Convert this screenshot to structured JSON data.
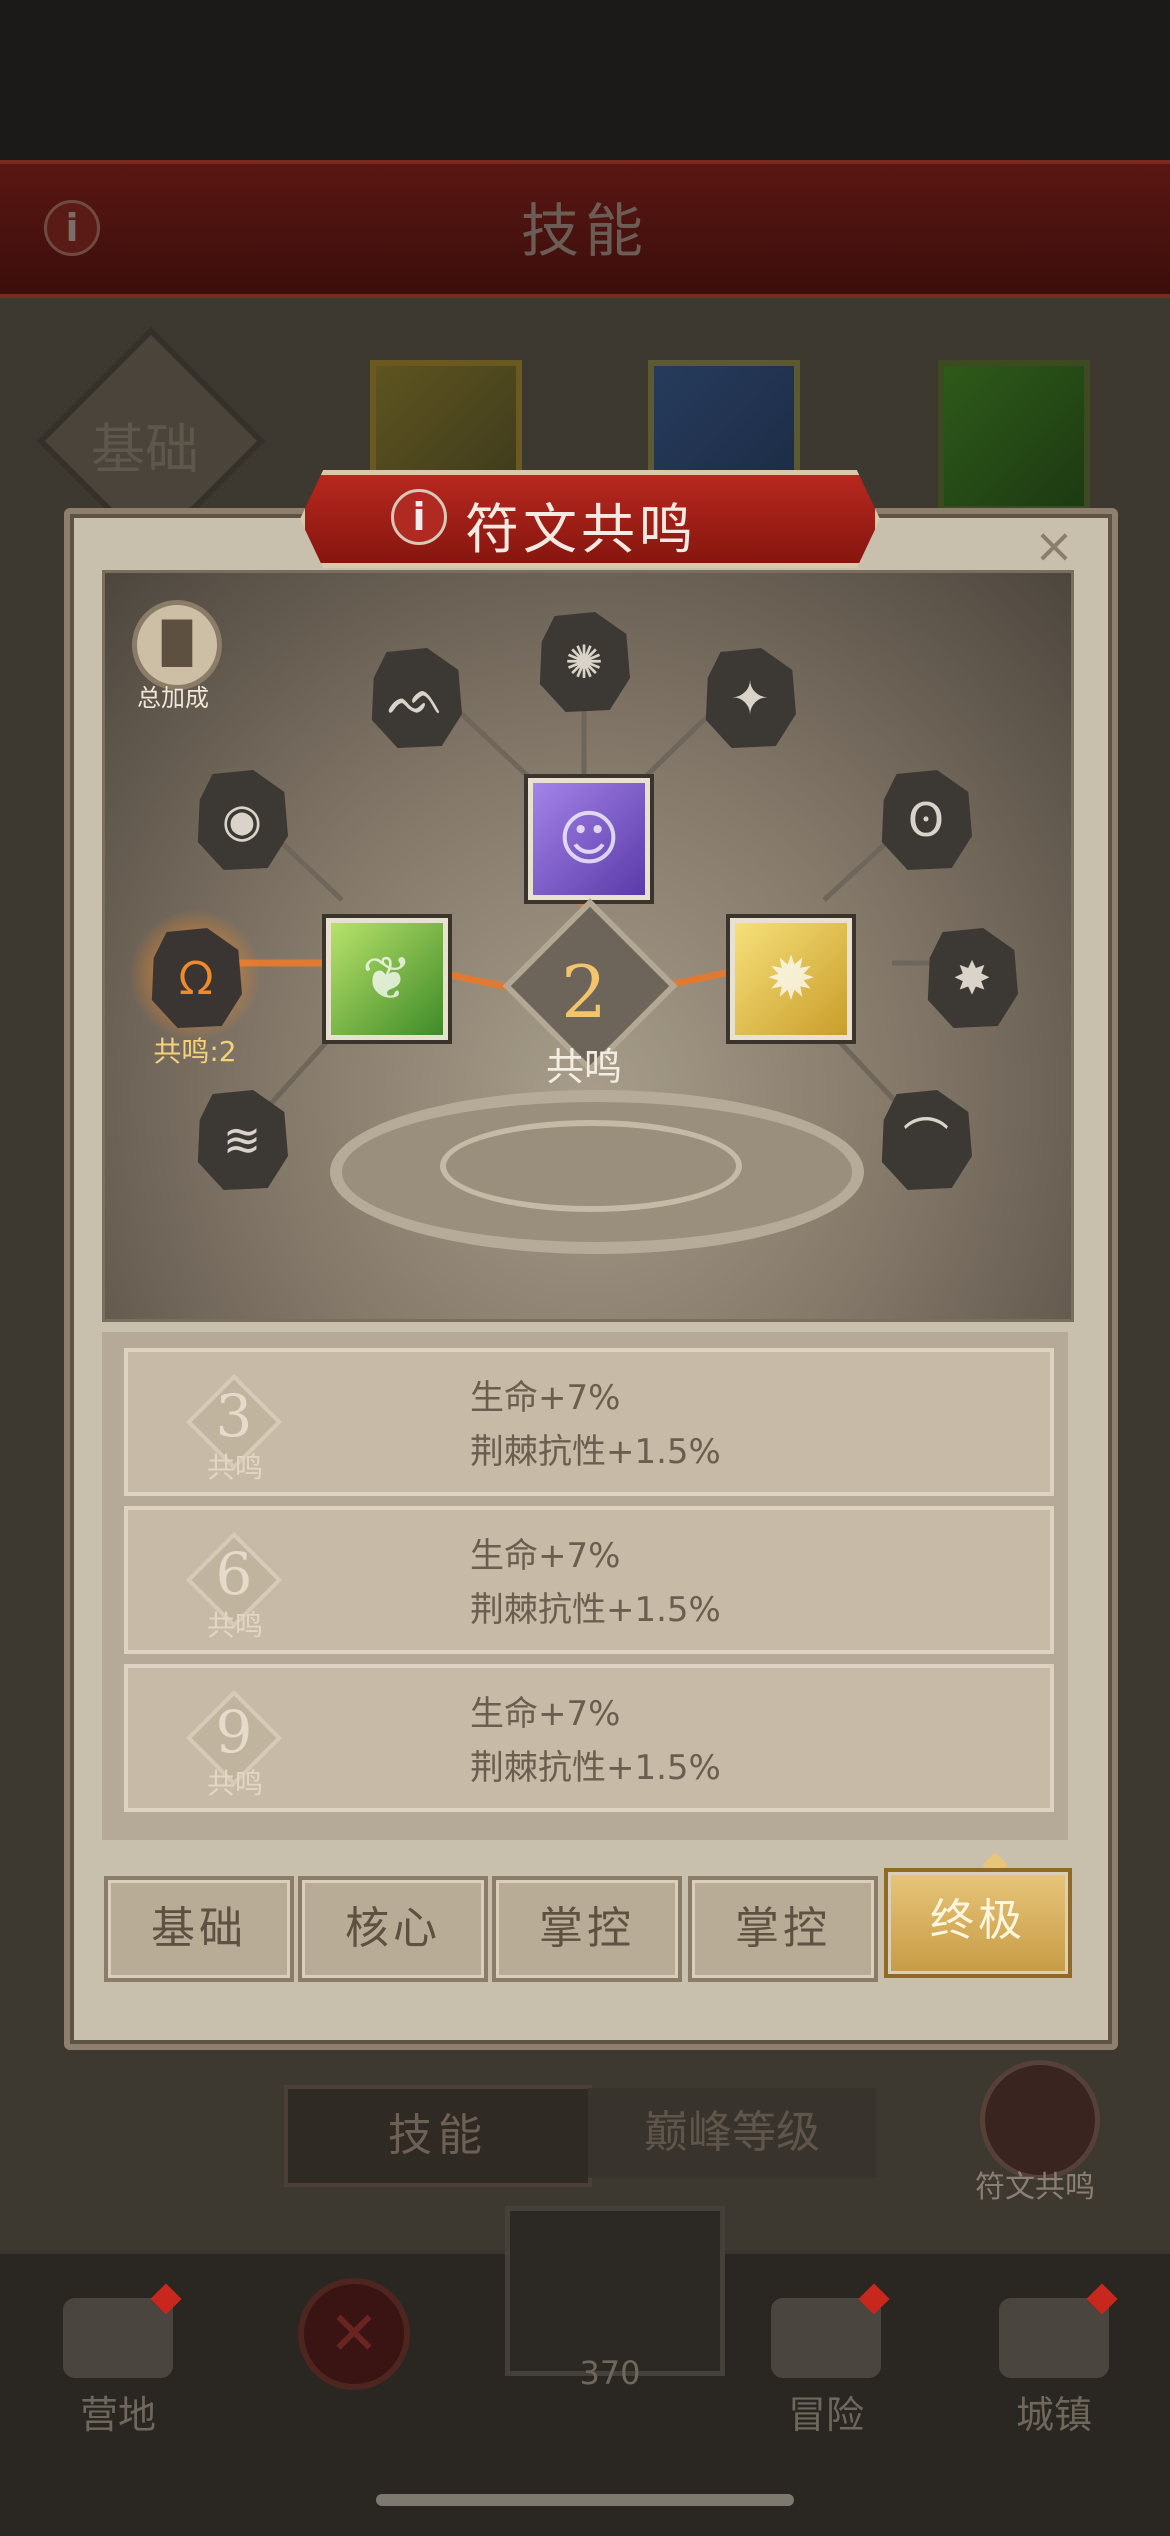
{
  "header": {
    "title": "技能",
    "info": "i"
  },
  "background": {
    "tab_basic": "基础",
    "bottom_tab_skill": "技能",
    "bottom_tab_peak": "巅峰等级",
    "rune_button_label": "符文共鸣"
  },
  "bottom_nav": {
    "items": [
      "营地",
      "冒险",
      "城镇"
    ],
    "close_glyph": "✕",
    "currency_value": "370"
  },
  "modal": {
    "title": "符文共鸣",
    "info": "i",
    "close": "×",
    "total_bonus_label": "总加成",
    "total_bonus_glyph": "▐▌",
    "active_rune_label": "共鸣:2",
    "center_value": "2",
    "center_label": "共鸣",
    "rune_glyphs": [
      "ᨒ",
      "✺",
      "✦",
      "◉",
      "ʘ",
      "✸",
      "≋",
      "✹",
      "☉",
      "⌒"
    ],
    "active_rune_glyph": "ᘯ",
    "rewards": [
      {
        "value": "3",
        "label": "共鸣",
        "line1": "生命+7%",
        "line2": "荆棘抗性+1.5%"
      },
      {
        "value": "6",
        "label": "共鸣",
        "line1": "生命+7%",
        "line2": "荆棘抗性+1.5%"
      },
      {
        "value": "9",
        "label": "共鸣",
        "line1": "生命+7%",
        "line2": "荆棘抗性+1.5%"
      }
    ],
    "tabs": [
      "基础",
      "核心",
      "掌控",
      "掌控",
      "终极"
    ],
    "selected_tab": "终极"
  },
  "colors": {
    "accent_red": "#b8281f",
    "gold": "#e7c57a",
    "rune_active": "#f08a2a"
  }
}
